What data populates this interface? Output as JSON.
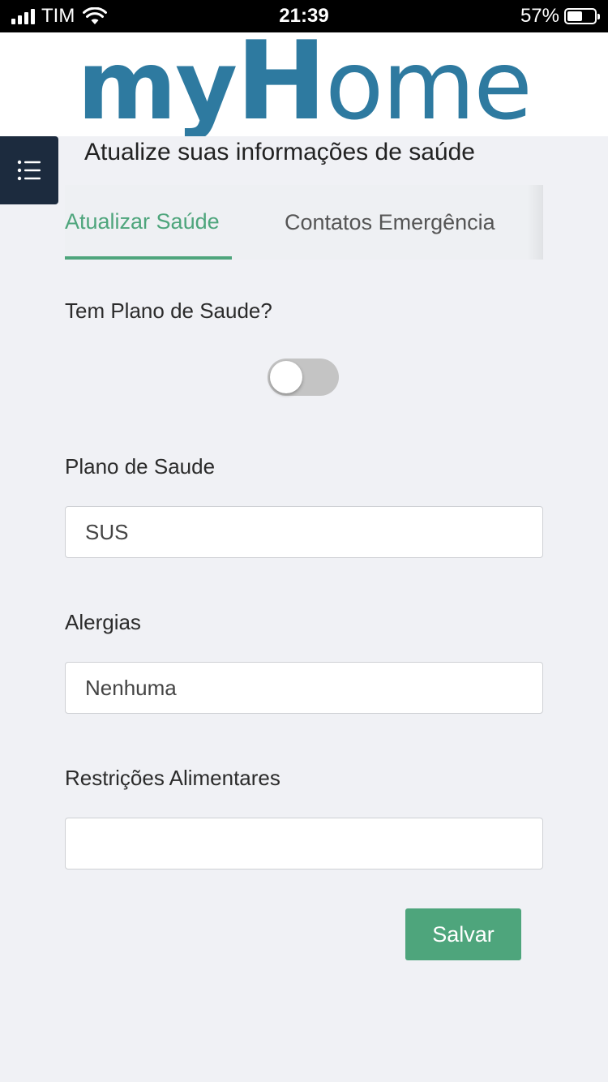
{
  "status_bar": {
    "carrier": "TIM",
    "time": "21:39",
    "battery_percent": "57%",
    "battery_level": 0.57
  },
  "header": {
    "logo_part1": "my",
    "logo_part2": "H",
    "logo_part3": "ome",
    "logo_color": "#2e7aa0"
  },
  "menu": {
    "icon": "list-icon"
  },
  "page": {
    "title": "Atualize suas informações de saúde"
  },
  "tabs": [
    {
      "label": "Atualizar Saúde",
      "active": true
    },
    {
      "label": "Contatos Emergência",
      "active": false
    }
  ],
  "form": {
    "has_plan_label": "Tem Plano de Saude?",
    "has_plan_value": false,
    "plan_label": "Plano de Saude",
    "plan_value": "SUS",
    "allergies_label": "Alergias",
    "allergies_value": "Nenhuma",
    "diet_label": "Restrições Alimentares",
    "diet_value": "",
    "save_label": "Salvar"
  },
  "colors": {
    "accent": "#4ea57c",
    "menu_bg": "#1c2b3e",
    "page_bg": "#f0f1f5"
  }
}
